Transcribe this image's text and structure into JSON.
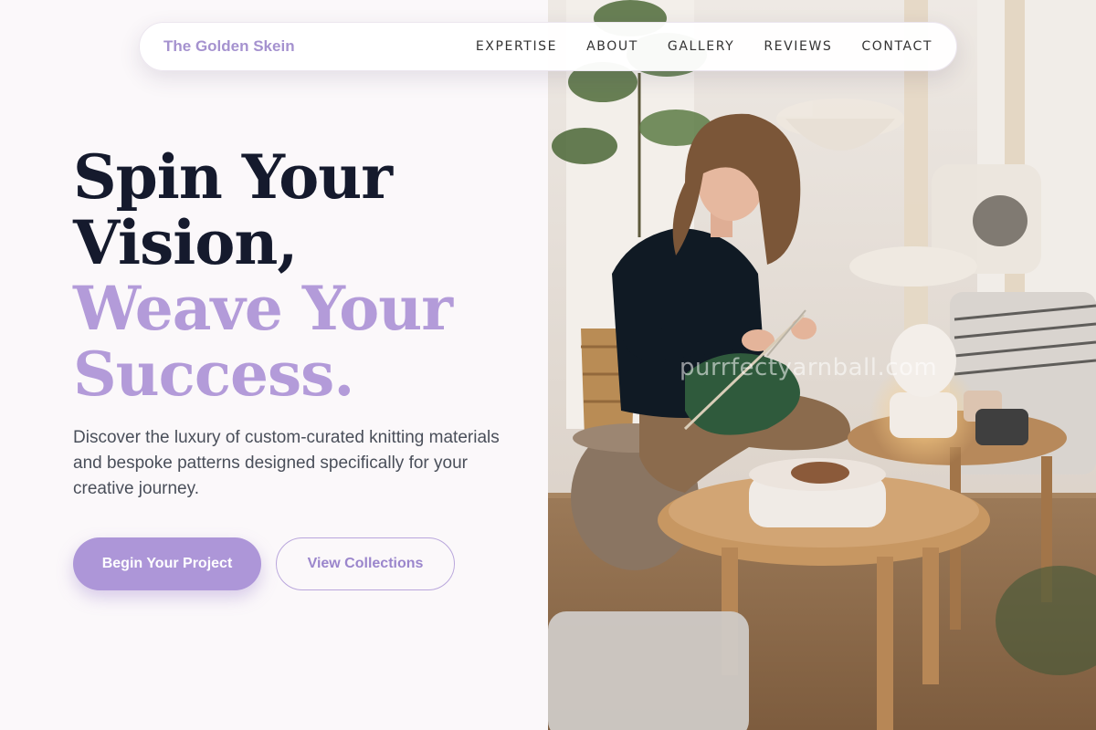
{
  "brand": {
    "name": "The Golden Skein"
  },
  "nav": {
    "links": [
      {
        "label": "EXPERTISE"
      },
      {
        "label": "ABOUT"
      },
      {
        "label": "GALLERY"
      },
      {
        "label": "REVIEWS"
      },
      {
        "label": "CONTACT"
      }
    ]
  },
  "hero": {
    "title_line1": "Spin Your",
    "title_line2": "Vision,",
    "title_line3": "Weave Your",
    "title_line4": "Success.",
    "description": "Discover the luxury of custom-curated knitting materials and bespoke patterns designed specifically for your creative journey.",
    "primary_button": "Begin Your Project",
    "secondary_button": "View Collections"
  },
  "image": {
    "watermark": "purrfectyarnball.com",
    "subject": "woman-knitting-photo"
  },
  "colors": {
    "accent": "#b39bd9",
    "button_primary": "#ad96d8",
    "title_dark": "#151a2d",
    "background": "#fbf8fa"
  }
}
